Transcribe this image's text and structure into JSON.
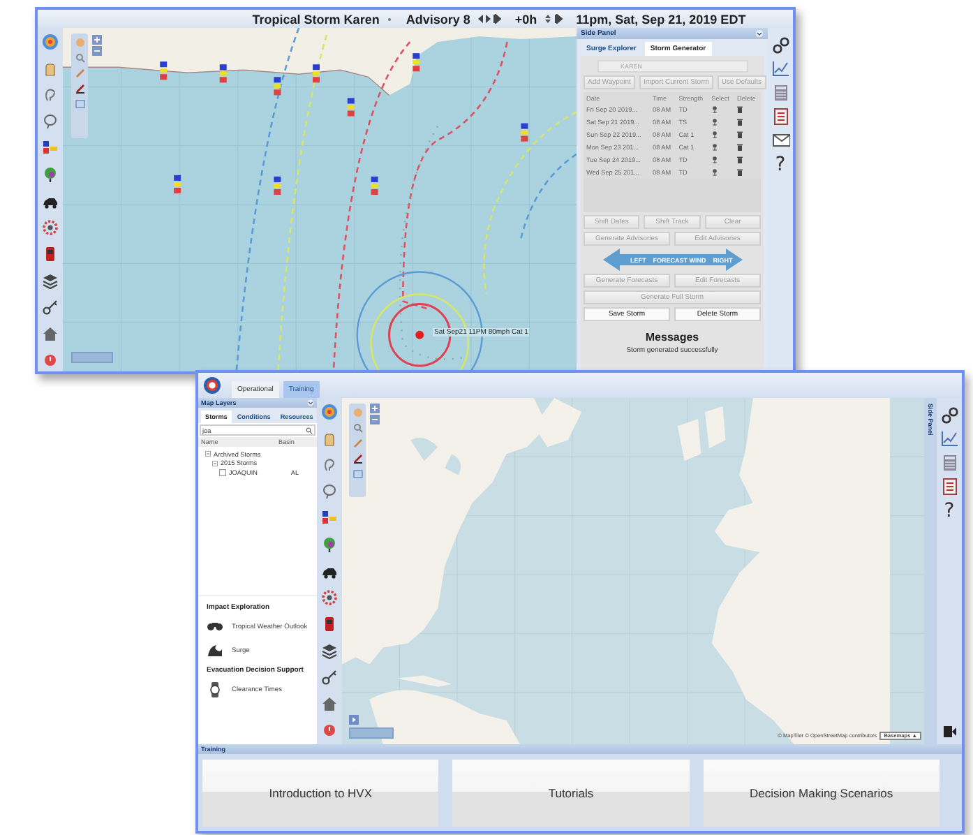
{
  "storm_window": {
    "title_bar": {
      "storm": "Tropical Storm Karen",
      "advisory": "Advisory 8",
      "offset": "+0h",
      "datetime": "11pm, Sat, Sep 21, 2019 EDT"
    },
    "map": {
      "storm_label": "Sat Sep21 11PM 80mph Cat 1"
    },
    "side_panel": {
      "title": "Side Panel",
      "tabs": [
        {
          "label": "Surge Explorer",
          "selected": false
        },
        {
          "label": "Storm Generator",
          "selected": true
        }
      ],
      "storm_name_field": {
        "value": "KAREN"
      },
      "top_buttons": [
        {
          "label": "Add Waypoint",
          "disabled": true
        },
        {
          "label": "Import Current Storm",
          "disabled": true
        },
        {
          "label": "Use Defaults",
          "disabled": true
        }
      ],
      "table": {
        "columns": [
          "Date",
          "Time",
          "Strength",
          "Select",
          "Delete"
        ],
        "rows": [
          {
            "date": "Fri Sep 20 2019...",
            "time": "08 AM",
            "strength": "TD"
          },
          {
            "date": "Sat Sep 21 2019...",
            "time": "08 AM",
            "strength": "TS"
          },
          {
            "date": "Sun Sep 22 2019...",
            "time": "08 AM",
            "strength": "Cat 1"
          },
          {
            "date": "Mon Sep 23 201...",
            "time": "08 AM",
            "strength": "Cat 1"
          },
          {
            "date": "Tue Sep 24 2019...",
            "time": "08 AM",
            "strength": "TD"
          },
          {
            "date": "Wed Sep 25 201...",
            "time": "08 AM",
            "strength": "TD"
          }
        ]
      },
      "button_rows": [
        [
          {
            "label": "Shift Dates",
            "disabled": true
          },
          {
            "label": "Shift Track",
            "disabled": true
          },
          {
            "label": "Clear",
            "disabled": true
          }
        ],
        [
          {
            "label": "Generate Advisories",
            "disabled": true
          },
          {
            "label": "Edit Advisories",
            "disabled": true
          }
        ]
      ],
      "nav_arrow": {
        "left": "LEFT",
        "middle": "FORECAST WIND",
        "right": "RIGHT"
      },
      "lower_button_rows": [
        [
          {
            "label": "Generate Forecasts",
            "disabled": true
          },
          {
            "label": "Edit Forecasts",
            "disabled": true
          }
        ],
        [
          {
            "label": "Generate Full Storm",
            "disabled": true
          }
        ],
        [
          {
            "label": "Save Storm",
            "disabled": false
          },
          {
            "label": "Delete Storm",
            "disabled": false
          }
        ]
      ],
      "messages": {
        "title": "Messages",
        "text": "Storm generated successfully"
      }
    },
    "help": "?"
  },
  "main_window": {
    "tabs": [
      {
        "label": "Operational",
        "selected": false
      },
      {
        "label": "Training",
        "selected": true
      }
    ],
    "map_layers": {
      "title": "Map Layers",
      "tabs": [
        {
          "label": "Storms",
          "selected": true
        },
        {
          "label": "Conditions",
          "selected": false
        },
        {
          "label": "Resources",
          "selected": false
        }
      ],
      "search": {
        "value": "joa"
      },
      "columns": [
        "Name",
        "Basin"
      ],
      "tree": [
        {
          "label": "Archived Storms",
          "expanded": true,
          "children": [
            {
              "label": "2015 Storms",
              "expanded": true,
              "children": [
                {
                  "label": "JOAQUIN",
                  "basin": "AL",
                  "checked": false
                }
              ]
            }
          ]
        }
      ]
    },
    "sections": [
      {
        "title": "Impact Exploration",
        "items": [
          {
            "label": "Tropical Weather Outlook",
            "kind": "binoculars"
          },
          {
            "label": "Surge",
            "kind": "wave"
          }
        ]
      },
      {
        "title": "Evacuation Decision Support",
        "items": [
          {
            "label": "Clearance Times",
            "kind": "watch"
          }
        ]
      }
    ],
    "side_panel_tab": "Side Panel",
    "help": "?",
    "attribution": "© MapTiler © OpenStreetMap contributors",
    "basemaps": "Basemaps ▲",
    "training": {
      "title": "Training",
      "cards": [
        "Introduction to HVX",
        "Tutorials",
        "Decision Making Scenarios"
      ]
    }
  }
}
